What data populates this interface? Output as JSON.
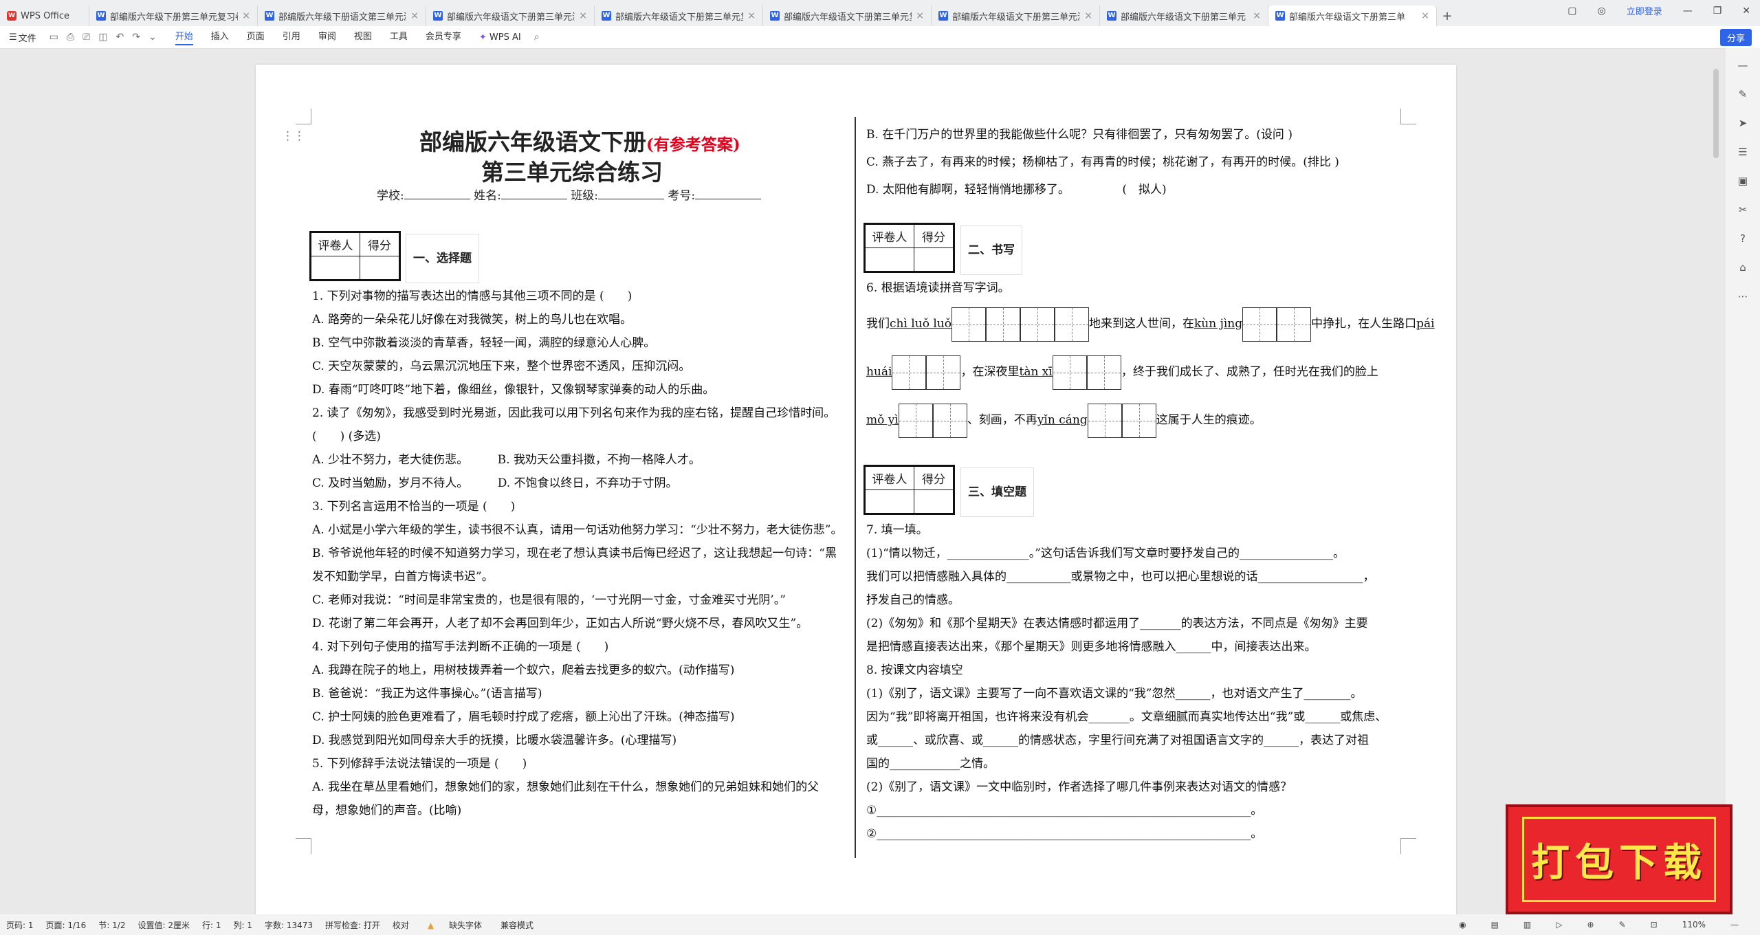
{
  "tabs": [
    {
      "label": "WPS Office",
      "kind": "home"
    },
    {
      "label": "部编版六年级下册第三单元复习卷.docx",
      "kind": "doc"
    },
    {
      "label": "部编版六年级下册语文第三单元测试",
      "kind": "doc"
    },
    {
      "label": "部编版六年级语文下册第三单元测试",
      "kind": "doc"
    },
    {
      "label": "部编版六年级语文下册第三单元复习",
      "kind": "doc"
    },
    {
      "label": "部编版六年级语文下册第三单元复习",
      "kind": "doc"
    },
    {
      "label": "部编版六年级语文下册第三单元测",
      "kind": "doc"
    },
    {
      "label": "部编版六年级语文下册第三单元",
      "kind": "doc"
    },
    {
      "label": "部编版六年级语文下册第三单",
      "kind": "doc",
      "active": true
    }
  ],
  "window": {
    "login": "立即登录",
    "share": "分享"
  },
  "ribbon": {
    "file": "文件",
    "tabs": [
      "开始",
      "插入",
      "页面",
      "引用",
      "审阅",
      "视图",
      "工具",
      "会员专享"
    ],
    "ai": "WPS AI"
  },
  "doc": {
    "title_main": "部编版六年级语文下册",
    "title_note": "(有参考答案)",
    "title_sub": "第三单元综合练习",
    "info": {
      "school": "学校:",
      "name": "姓名:",
      "class": "班级:",
      "exam_no": "考号:"
    },
    "grade": {
      "reviewer": "评卷人",
      "score": "得分"
    },
    "sections": {
      "s1": "一、选择题",
      "s2": "二、书写",
      "s3": "三、填空题"
    },
    "left_lines": [
      "1. 下列对事物的描写表达出的情感与其他三项不同的是 (　　)",
      "A. 路旁的一朵朵花儿好像在对我微笑，树上的鸟儿也在欢唱。",
      "B. 空气中弥散着淡淡的青草香，轻轻一闻，满腔的绿意沁人心脾。",
      "C. 天空灰蒙蒙的，乌云黑沉沉地压下来，整个世界密不透风，压抑沉闷。",
      "D. 春雨“叮咚叮咚”地下着，像细丝，像银针，又像钢琴家弹奏的动人的乐曲。",
      "2. 读了《匆匆》，我感受到时光易逝，因此我可以用下列名句来作为我的座右铭，提醒自己珍惜时间。",
      "(　　) (多选)",
      "A. 少壮不努力，老大徒伤悲。　　　B. 我劝天公重抖擞，不拘一格降人才。",
      "C. 及时当勉励，岁月不待人。　　　D. 不饱食以终日，不弃功于寸阴。",
      "3. 下列名言运用不恰当的一项是 (　　)",
      "A. 小斌是小学六年级的学生，读书很不认真，请用一句话劝他努力学习：“少壮不努力，老大徒伤悲”。",
      "B. 爷爷说他年轻的时候不知道努力学习，现在老了想认真读书后悔已经迟了，这让我想起一句诗：“黑",
      "发不知勤学早，白首方悔读书迟”。",
      "C. 老师对我说：“时间是非常宝贵的，也是很有限的，‘一寸光阴一寸金，寸金难买寸光阴’。”",
      "D. 花谢了第二年会再开，人老了却不会再回到年少，正如古人所说“野火烧不尽，春风吹又生”。",
      "4. 对下列句子使用的描写手法判断不正确的一项是 (　　)",
      "A. 我蹲在院子的地上，用树枝拨弄着一个蚁穴，爬着去找更多的蚁穴。(动作描写)",
      "B. 爸爸说：“我正为这件事操心。”(语言描写)",
      "C. 护士阿姨的脸色更难看了，眉毛顿时拧成了疙瘩，额上沁出了汗珠。(神态描写)",
      "D. 我感觉到阳光如同母亲大手的抚摸，比暖水袋温馨许多。(心理描写)",
      "5. 下列修辞手法说法错误的一项是 (　　)",
      "A. 我坐在草丛里看她们，想象她们的家，想象她们此刻在干什么，想象她们的兄弟姐妹和她们的父",
      "母，想象她们的声音。(比喻)"
    ],
    "right_top_lines": [
      "B. 在千门万户的世界里的我能做些什么呢？只有徘徊罢了，只有匆匆罢了。(设问 )",
      "C. 燕子去了，有再来的时候；杨柳枯了，有再青的时候；桃花谢了，有再开的时候。(排比 )",
      "D. 太阳他有脚啊，轻轻悄悄地挪移了。　　　　　(　拟人)"
    ],
    "q6": "6. 根据语境读拼音写字词。",
    "w": {
      "t1": "我们",
      "p1": "chì luǒ luǒ",
      "t2": "地来到这人世间，在",
      "p2": "kùn jìng",
      "t3": "中挣扎，在人生路口",
      "p3": "pái",
      "p3b": "huái",
      "t4": "，在深夜里",
      "p4": "tàn xī",
      "t5": "，终于我们成长了、成熟了，任时光在我们的脸上",
      "p5": "mǒ yì",
      "t6": "、刻画，不再",
      "p6": "yǐn cáng",
      "t7": "这属于人生的痕迹。"
    },
    "right_bottom_lines": [
      "7. 填一填。",
      "(1)“情以物迁，______________。”这句话告诉我们写文章时要抒发自己的________________。",
      "我们可以把情感融入具体的___________或景物之中，也可以把心里想说的话__________________，",
      "抒发自己的情感。",
      "(2)《匆匆》和《那个星期天》在表达情感时都运用了_______的表达方法，不同点是《匆匆》主要",
      "是把情感直接表达出来，《那个星期天》则更多地将情感融入______中，间接表达出来。",
      "8. 按课文内容填空",
      "(1)《别了，语文课》主要写了一向不喜欢语文课的“我”忽然______，也对语文产生了________。",
      "因为“我”即将离开祖国，也许将来没有机会_______。文章细腻而真实地传达出“我”或______或焦虑、",
      "或______、或欣喜、或______的情感状态，字里行间充满了对祖国语言文字的______，表达了对祖",
      "国的____________之情。",
      "(2)《别了，语文课》一文中临别时，作者选择了哪几件事例来表达对语文的情感？",
      "①________________________________________________________________。",
      "②________________________________________________________________。"
    ]
  },
  "statusbar": {
    "page": "页码: 1",
    "pages": "页面: 1/16",
    "section": "节: 1/2",
    "setting": "设置值: 2厘米",
    "row": "行: 1",
    "col": "列: 1",
    "words": "字数: 13473",
    "spell": "拼写检查: 打开",
    "proof": "校对",
    "font_missing": "缺失字体",
    "compat": "兼容模式",
    "zoom": "110%"
  },
  "download_banner": "打包下载"
}
